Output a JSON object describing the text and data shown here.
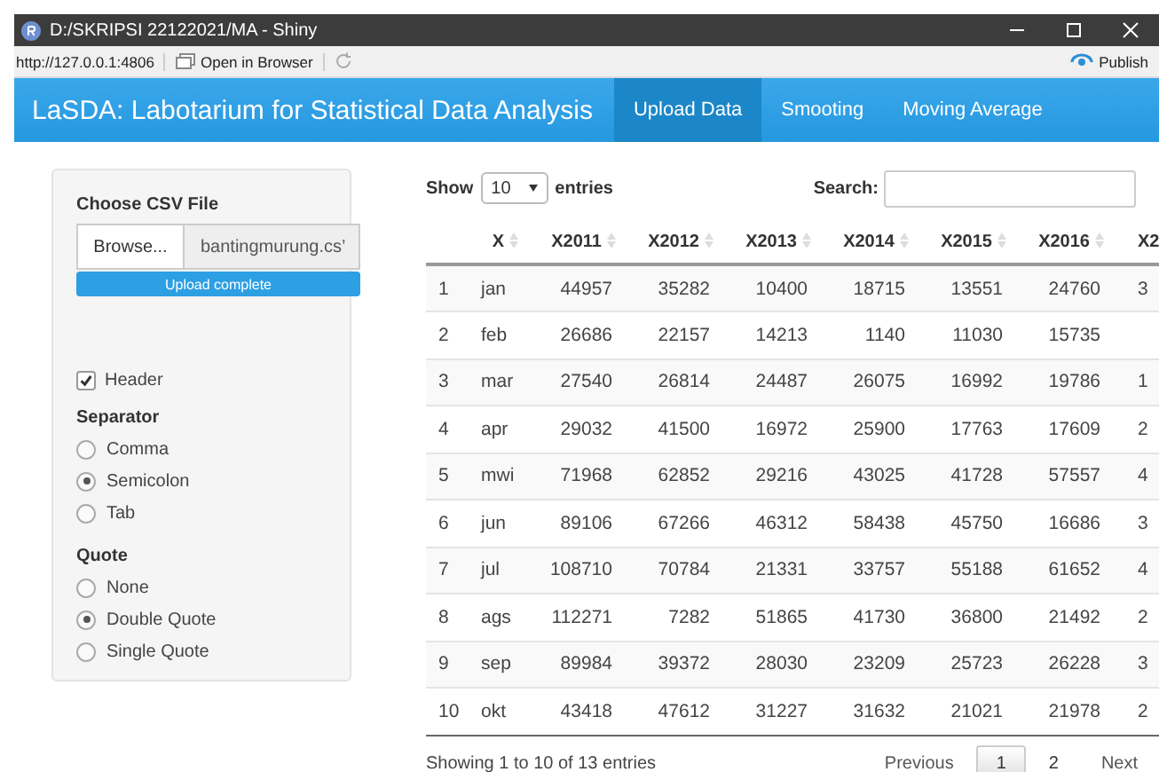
{
  "window": {
    "title": "D:/SKRIPSI 22122021/MA - Shiny"
  },
  "toolbar": {
    "url": "http://127.0.0.1:4806",
    "open_button": "Open in Browser",
    "publish_button": "Publish"
  },
  "navbar": {
    "brand": "LaSDA: Labotarium for Statistical Data Analysis",
    "tabs": [
      {
        "label": "Upload Data",
        "selected": true
      },
      {
        "label": "Smooting",
        "selected": false
      },
      {
        "label": "Moving Average",
        "selected": false
      }
    ]
  },
  "sidebar": {
    "file_label": "Choose CSV File",
    "browse_button": "Browse...",
    "file_name": "bantingmurung.cs’",
    "progress": {
      "label": "Upload complete",
      "level": 1
    },
    "header_checkbox": {
      "label": "Header",
      "checked": true
    },
    "groups": [
      {
        "title": "Separator",
        "options": [
          {
            "label": "Comma",
            "selected": false
          },
          {
            "label": "Semicolon",
            "selected": true
          },
          {
            "label": "Tab",
            "selected": false
          }
        ]
      },
      {
        "title": "Quote",
        "options": [
          {
            "label": "None",
            "selected": false
          },
          {
            "label": "Double Quote",
            "selected": true
          },
          {
            "label": "Single Quote",
            "selected": false
          }
        ]
      }
    ]
  },
  "table": {
    "length_label_before": "Show",
    "length_value": "10",
    "length_label_after": "entries",
    "search_label": "Search:",
    "columns": [
      "X",
      "X2011",
      "X2012",
      "X2013",
      "X2014",
      "X2015",
      "X2016",
      "X2"
    ],
    "rows": [
      {
        "index": "1",
        "cells": [
          "jan",
          "44957",
          "35282",
          "10400",
          "18715",
          "13551",
          "24760",
          "3"
        ]
      },
      {
        "index": "2",
        "cells": [
          "feb",
          "26686",
          "22157",
          "14213",
          "1140",
          "11030",
          "15735",
          null
        ]
      },
      {
        "index": "3",
        "cells": [
          "mar",
          "27540",
          "26814",
          "24487",
          "26075",
          "16992",
          "19786",
          "1"
        ]
      },
      {
        "index": "4",
        "cells": [
          "apr",
          "29032",
          "41500",
          "16972",
          "25900",
          "17763",
          "17609",
          "2"
        ]
      },
      {
        "index": "5",
        "cells": [
          "mwi",
          "71968",
          "62852",
          "29216",
          "43025",
          "41728",
          "57557",
          "4"
        ]
      },
      {
        "index": "6",
        "cells": [
          "jun",
          "89106",
          "67266",
          "46312",
          "58438",
          "45750",
          "16686",
          "3"
        ]
      },
      {
        "index": "7",
        "cells": [
          "jul",
          "108710",
          "70784",
          "21331",
          "33757",
          "55188",
          "61652",
          "4"
        ]
      },
      {
        "index": "8",
        "cells": [
          "ags",
          "112271",
          "7282",
          "51865",
          "41730",
          "36800",
          "21492",
          "2"
        ]
      },
      {
        "index": "9",
        "cells": [
          "sep",
          "89984",
          "39372",
          "28030",
          "23209",
          "25723",
          "26228",
          "3"
        ]
      },
      {
        "index": "10",
        "cells": [
          "okt",
          "43418",
          "47612",
          "31227",
          "31632",
          "21021",
          "21978",
          "2"
        ]
      }
    ],
    "info": "Showing 1 to 10 of 13 entries",
    "pagination": [
      {
        "label": "Previous",
        "kind": "nav",
        "selected": false
      },
      {
        "label": "1",
        "kind": "page",
        "selected": true
      },
      {
        "label": "2",
        "kind": "page",
        "selected": false
      },
      {
        "label": "Next",
        "kind": "nav",
        "selected": false
      }
    ]
  }
}
